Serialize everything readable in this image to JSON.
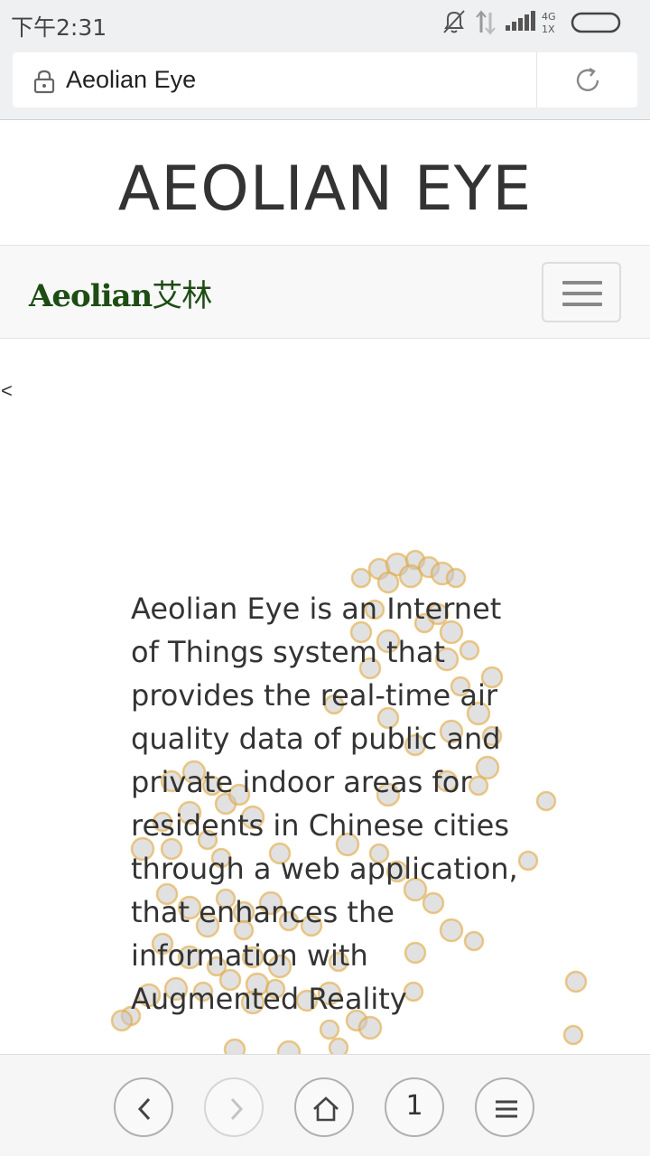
{
  "status_bar": {
    "time": "下午2:31",
    "network_label_top": "4G",
    "network_label_bottom": "1X",
    "icons": [
      "mute-bell-icon",
      "data-transfer-icon",
      "signal-icon",
      "battery-icon"
    ]
  },
  "browser": {
    "url_text": "Aeolian Eye",
    "icons": [
      "lock-icon",
      "reload-icon"
    ]
  },
  "page": {
    "site_title": "AEOLIAN EYE",
    "brand_latin": "Aeolian",
    "brand_chinese": "艾林",
    "toggle_icon": "hamburger-icon",
    "prev_arrow": "<",
    "description": "Aeolian Eye is an Internet of Things system that provides the real-time air quality data of public and private indoor areas for residents in Chinese cities through a web application, that enhances the information with Augmented Reality"
  },
  "bottom_toolbar": {
    "tab_count": "1",
    "icons": [
      "back-icon",
      "forward-icon",
      "home-icon",
      "tabs-icon",
      "menu-icon"
    ]
  },
  "colors": {
    "brand_green": "#1e4d14",
    "bubble_fill": "#c9c9c9",
    "bubble_ring": "#e3a93c",
    "chrome_bg": "#eef0f2"
  }
}
